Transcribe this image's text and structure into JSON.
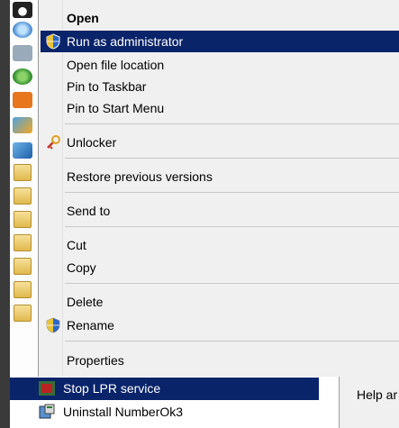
{
  "context_menu": {
    "items": [
      {
        "label": "Open",
        "bold": true
      },
      {
        "label": "Run as administrator",
        "icon": "uac-shield-icon",
        "highlighted": true
      },
      {
        "label": "Open file location"
      },
      {
        "label": "Pin to Taskbar"
      },
      {
        "label": "Pin to Start Menu"
      },
      {
        "label": "Unlocker",
        "icon": "unlocker-icon"
      },
      {
        "label": "Restore previous versions"
      },
      {
        "label": "Send to"
      },
      {
        "label": "Cut"
      },
      {
        "label": "Copy"
      },
      {
        "label": "Delete"
      },
      {
        "label": "Rename",
        "icon": "uac-shield-icon"
      },
      {
        "label": "Properties"
      }
    ]
  },
  "start_list": {
    "items": [
      {
        "label": "Stop LPR service",
        "icon": "service-stop-icon",
        "highlighted": true
      },
      {
        "label": "Uninstall NumberOk3",
        "icon": "uninstall-icon"
      }
    ]
  },
  "right_panel": {
    "text": "Help ar"
  },
  "colors": {
    "highlight": "#0a246a",
    "menu_bg": "#f0f0f0"
  }
}
